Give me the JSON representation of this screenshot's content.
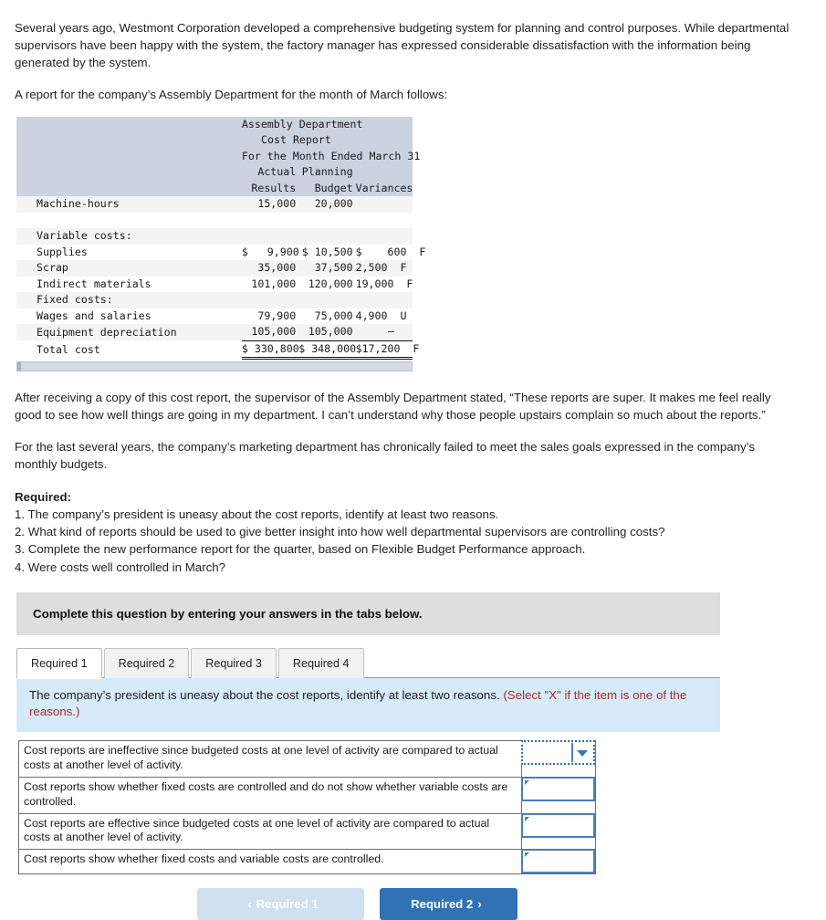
{
  "intro": {
    "paragraph1": "Several years ago, Westmont Corporation developed a comprehensive budgeting system for planning and control purposes. While departmental supervisors have been happy with the system, the factory manager has expressed considerable dissatisfaction with the information being generated by the system.",
    "paragraph2": "A report for the company’s Assembly Department for the month of March follows:"
  },
  "report": {
    "title_line1": "Assembly Department",
    "title_line2": "Cost Report",
    "title_line3": "For the Month Ended March 31",
    "col_head1_line1": "Actual",
    "col_head1_line2": "Results",
    "col_head2_line1": "Planning",
    "col_head2_line2": "Budget",
    "col_head3": "Variances",
    "rows": [
      {
        "label": "Machine-hours",
        "actual": "15,000",
        "budget": "20,000",
        "variance": ""
      },
      {
        "label": "Variable costs:",
        "actual": "",
        "budget": "",
        "variance": ""
      },
      {
        "label": "Supplies",
        "actual": "$   9,900",
        "budget": "$ 10,500",
        "variance": "$    600  F"
      },
      {
        "label": "Scrap",
        "actual": "35,000",
        "budget": "37,500",
        "variance": "2,500  F"
      },
      {
        "label": "Indirect materials",
        "actual": "101,000",
        "budget": "120,000",
        "variance": "19,000  F"
      },
      {
        "label": "Fixed costs:",
        "actual": "",
        "budget": "",
        "variance": ""
      },
      {
        "label": "Wages and salaries",
        "actual": "79,900",
        "budget": "75,000",
        "variance": "4,900  U"
      },
      {
        "label": "Equipment depreciation",
        "actual": "105,000",
        "budget": "105,000",
        "variance": "–"
      },
      {
        "label": "Total cost",
        "actual": "$ 330,800",
        "budget": "$ 348,000",
        "variance": "$17,200  F"
      }
    ]
  },
  "body": {
    "paragraph3": "After receiving a copy of this cost report, the supervisor of the Assembly Department stated, “These reports are super. It makes me feel really good to see how well things are going in my department. I can’t understand why those people upstairs complain so much about the reports.”",
    "paragraph4": "For the last several years, the company’s marketing department has chronically failed to meet the sales goals expressed in the company’s monthly budgets."
  },
  "required": {
    "title": "Required:",
    "items": [
      "1. The company’s president is uneasy about the cost reports, identify at least two reasons.",
      "2. What kind of reports should be used to give better insight into how well departmental supervisors are controlling costs?",
      "3. Complete the new performance report for the quarter, based on Flexible Budget Performance approach.",
      "4. Were costs well controlled in March?"
    ]
  },
  "instruction_bar": {
    "text": "Complete this question by entering your answers in the tabs below."
  },
  "tabs": [
    {
      "label": "Required 1",
      "active": true
    },
    {
      "label": "Required 2",
      "active": false
    },
    {
      "label": "Required 3",
      "active": false
    },
    {
      "label": "Required 4",
      "active": false
    }
  ],
  "banner": {
    "main": "The company’s president is uneasy about the cost reports, identify at least two reasons. ",
    "hint": "(Select \"X\" if the item is one of the reasons.)"
  },
  "answers": {
    "rows": [
      {
        "text": "Cost reports are ineffective since budgeted costs at one level of activity are compared to actual costs at another level of activity.",
        "value": ""
      },
      {
        "text": "Cost reports show whether fixed costs are controlled and do not show whether variable costs are controlled.",
        "value": ""
      },
      {
        "text": "Cost reports are effective since budgeted costs at one level of activity are compared to actual costs at another level of activity.",
        "value": ""
      },
      {
        "text": "Cost reports show whether fixed costs and variable costs are controlled.",
        "value": ""
      }
    ]
  },
  "nav": {
    "prev_label": "Required 1",
    "next_label": "Required 2",
    "prev_chevron": "‹",
    "next_chevron": "›"
  },
  "colors": {
    "accent_blue": "#3072b4",
    "banner_blue": "#d6eafa",
    "hint_red": "#b02b2b",
    "table_header": "#ccd3e0",
    "instruction_gray": "#dedede"
  }
}
